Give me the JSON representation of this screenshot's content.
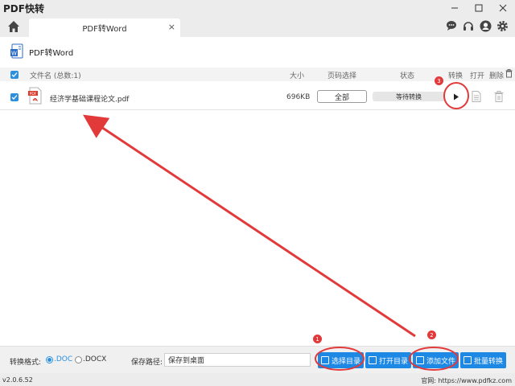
{
  "window": {
    "title": "PDF快转",
    "controls": [
      "minimize",
      "maximize",
      "close"
    ]
  },
  "tabs": {
    "home_icon": "home-icon",
    "active_tab": "PDF转Word",
    "close_glyph": "×"
  },
  "toolbar_icons": [
    "chat-icon",
    "headset-icon",
    "user-icon",
    "settings-icon"
  ],
  "section": {
    "title": "PDF转Word"
  },
  "table": {
    "headers": {
      "filename": "文件名 (总数:1)",
      "size": "大小",
      "page_select": "页码选择",
      "status": "状态",
      "convert": "转换",
      "open": "打开",
      "delete": "删除"
    },
    "rows": [
      {
        "filename": "经济学基础课程论文.pdf",
        "size": "696KB",
        "pages": "全部",
        "status": "等待转换"
      }
    ]
  },
  "bottom": {
    "format_label": "转换格式:",
    "options": [
      ".DOC",
      ".DOCX"
    ],
    "selected": ".DOC",
    "path_label": "保存路径:",
    "path_value": "保存到桌面",
    "buttons": {
      "choose_dir": "选择目录",
      "open_dir": "打开目录",
      "add_file": "添加文件",
      "batch": "批量转换"
    }
  },
  "statusbar": {
    "version": "v2.0.6.52",
    "site": "官网: https://www.pdfkz.com"
  },
  "annotations": {
    "badges": [
      "1",
      "2",
      "3"
    ],
    "color": "#e23a3a"
  },
  "colors": {
    "accent": "#1e88e5",
    "annotation": "#e23a3a"
  }
}
